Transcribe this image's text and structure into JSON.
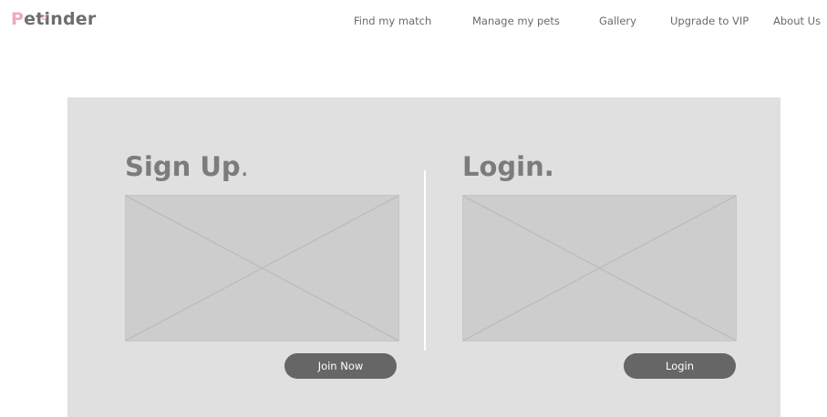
{
  "header": {
    "logo_first": "P",
    "logo_rest": "etinder",
    "logo_accent_color": "#f0a8c3"
  },
  "nav": {
    "items": [
      {
        "label": "Find my match"
      },
      {
        "label": "Manage my pets"
      },
      {
        "label": "Gallery"
      },
      {
        "label": "Upgrade to VIP"
      },
      {
        "label": "About Us"
      }
    ]
  },
  "signup": {
    "title": "Sign Up",
    "title_suffix": ".",
    "button_label": "Join Now"
  },
  "login": {
    "title": "Login.",
    "button_label": "Login"
  },
  "colors": {
    "panel_background": "#e0e0e0",
    "placeholder_background": "#cdcdcd",
    "button_background": "#666666"
  }
}
